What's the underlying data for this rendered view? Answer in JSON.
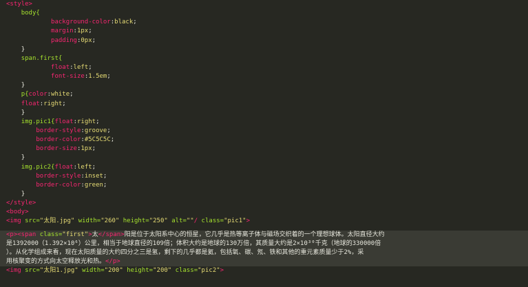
{
  "code": {
    "l01": "<style>",
    "l02_sel": "body{",
    "l03_prop": "background-color",
    "l03_val": "black",
    "l04_prop": "margin",
    "l04_val": "1px",
    "l05_prop": "padding",
    "l05_val": "0px",
    "l06": "}",
    "l07_sel": "span.first{",
    "l08_prop": "float",
    "l08_val": "left",
    "l09_prop": "font-size",
    "l09_val": "1.5em",
    "l10": "}",
    "l11_sel": "p{",
    "l11_prop": "color",
    "l11_val": "white",
    "l12_prop": "float",
    "l12_val": "right",
    "l13": "}",
    "l14_sel": "img.pic1{",
    "l14_prop": "float",
    "l14_val": "right",
    "l15_prop": "border-style",
    "l15_val": "groove",
    "l16_prop": "border-color",
    "l16_val": "#5C5C5C",
    "l17_prop": "border-size",
    "l17_val": "1px",
    "l18": "}",
    "l19_sel": "img.pic2{",
    "l19_prop": "float",
    "l19_val": "left",
    "l20_prop": "border-style",
    "l20_val": "inset",
    "l21_prop": "border-color",
    "l21_val": "green",
    "l22": "}",
    "l23": "</style>",
    "l24": "<body>",
    "l25_tag": "<img",
    "l25_a1": " src=",
    "l25_v1": "\"太阳.jpg\"",
    "l25_a2": " width=",
    "l25_v2": "\"260\"",
    "l25_a3": " height=",
    "l25_v3": "\"250\"",
    "l25_a4": " alt=",
    "l25_v4": "\"\"",
    "l25_tail": "/",
    "l25_a5": " class=",
    "l25_v5": "\"pic1\"",
    "l25_end": ">",
    "l27_open": "<p><span",
    "l27_a1": " class=",
    "l27_v1": "\"first\"",
    "l27_gt": ">",
    "l27_t1": "太",
    "l27_close": "</span>",
    "l27_t2": "阳是位于太阳系中心的恒星，它几乎是热等离子体与磁场交织着的一个理想球体。太阳直径大约",
    "l28": "是1392000（1.392×10⁶）公里，相当于地球直径的109倍；体积大约是地球的130万倍，其质量大约是2×10³⁰千克（地球的330000倍",
    "l29": "）。从化学组成来看，现在太阳质量的大约四分之三是氢，剩下的几乎都是氦，包括氧、碳、氖、铁和其他的重元素质量少于2%，采",
    "l30_t": "用核聚变的方式向太空释放光和热。",
    "l30_close": "</p>",
    "l31_tag": "<img",
    "l31_a1": " src=",
    "l31_v1": "\"太阳1.jpg\"",
    "l31_a2": " width=",
    "l31_v2": "\"200\"",
    "l31_a3": " height=",
    "l31_v3": "\"200\"",
    "l31_a4": " class=",
    "l31_v4": "\"pic2\"",
    "l31_end": ">"
  },
  "colors": {
    "background": "#272822",
    "tag": "#f92672",
    "selector": "#a6e22e",
    "value": "#e6db74"
  }
}
